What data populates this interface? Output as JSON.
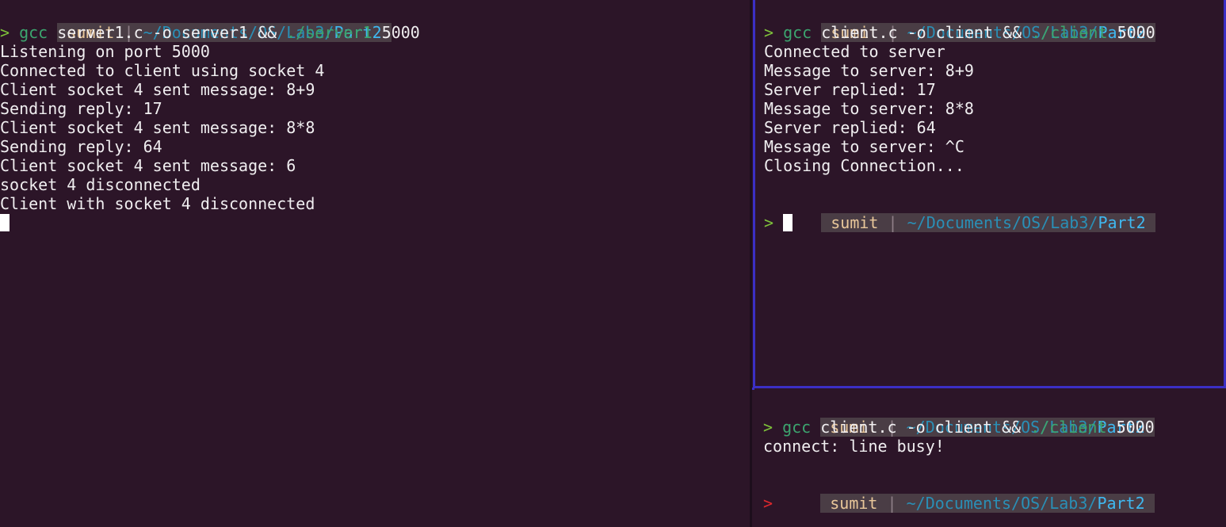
{
  "colors": {
    "background": "#2c1528",
    "prompt_bar_bg": "#4a3d45",
    "user": "#e9c79a",
    "path": "#2a8fb6",
    "dir": "#3fb8f0",
    "arrow_ok": "#7ec23a",
    "arrow_err": "#e0282d",
    "command": "#3ca56f",
    "active_pane_border": "#3b2fc4"
  },
  "prompt": {
    "user": "sumit",
    "separator": "|",
    "path": "~/Documents/OS/Lab3/",
    "dir": "Part2",
    "arrow": ">"
  },
  "left_pane": {
    "cmd_gcc": "gcc",
    "cmd_args": "server1.c -o server1 &&",
    "cmd_run": "./server1",
    "cmd_port": "5000",
    "output": [
      "Listening on port 5000",
      "Connected to client using socket 4",
      "Client socket 4 sent message: 8+9",
      "Sending reply: 17",
      "Client socket 4 sent message: 8*8",
      "Sending reply: 64",
      "Client socket 4 sent message: 6",
      "socket 4 disconnected",
      "Client with socket 4 disconnected"
    ]
  },
  "top_right_pane": {
    "cmd_gcc": "gcc",
    "cmd_args": "client.c -o client &&",
    "cmd_run": "./client",
    "cmd_port": "5000",
    "output": [
      "Connected to server",
      "Message to server: 8+9",
      "Server replied: 17",
      "Message to server: 8*8",
      "Server replied: 64",
      "Message to server: ^C",
      "Closing Connection..."
    ]
  },
  "bottom_right_pane": {
    "cmd_gcc": "gcc",
    "cmd_args": "client.c -o client &&",
    "cmd_run": "./client",
    "cmd_port": "5000",
    "output": [
      "connect: line busy!"
    ]
  }
}
